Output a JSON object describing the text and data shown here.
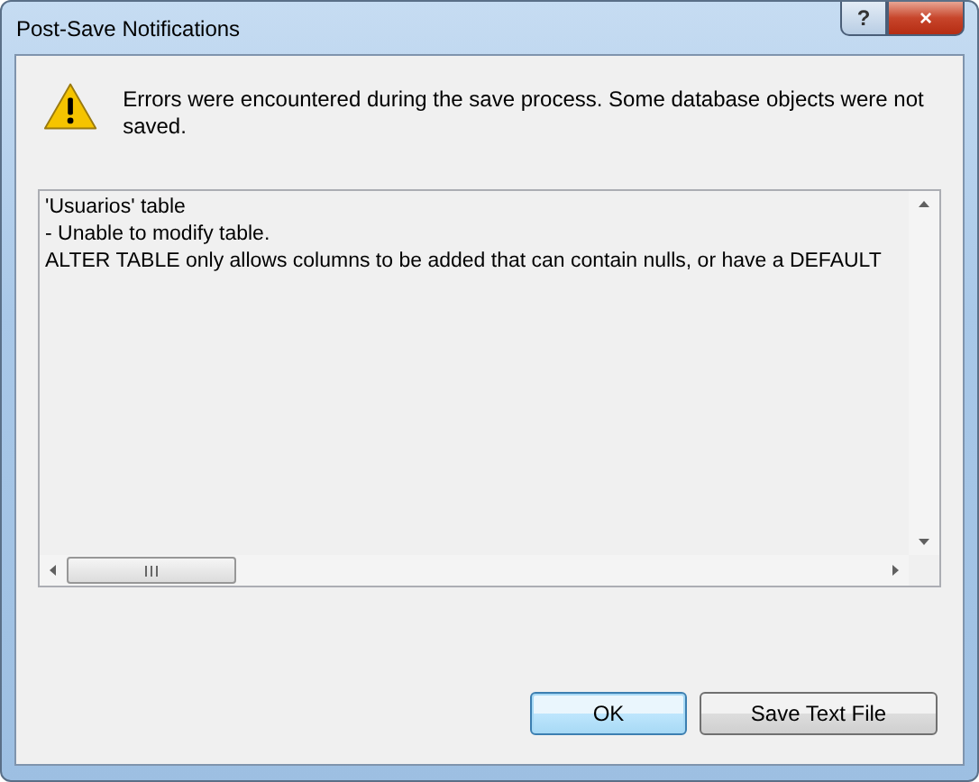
{
  "window": {
    "title": "Post-Save Notifications",
    "buttons": [
      "?",
      "×"
    ]
  },
  "message": "Errors were encountered during the save process. Some database objects were not saved.",
  "details": [
    "'Usuarios' table",
    "- Unable to modify table.",
    "ALTER TABLE only allows columns to be added that can contain nulls, or have a DEFAULT"
  ],
  "buttons": [
    {
      "label": "OK",
      "selected": true
    },
    {
      "label": "Save Text File",
      "selected": false
    }
  ]
}
